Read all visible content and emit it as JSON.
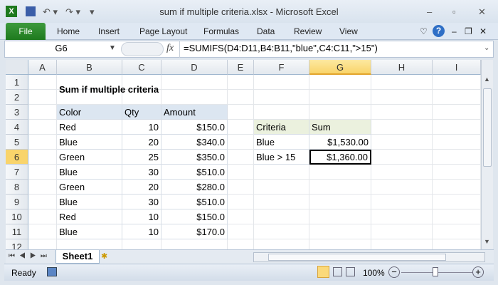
{
  "window": {
    "title": "sum if multiple criteria.xlsx  -  Microsoft Excel"
  },
  "ribbon": {
    "tabs": [
      "File",
      "Home",
      "Insert",
      "Page Layout",
      "Formulas",
      "Data",
      "Review",
      "View"
    ]
  },
  "formula_bar": {
    "name_box": "G6",
    "fx": "fx",
    "formula": "=SUMIFS(D4:D11,B4:B11,\"blue\",C4:C11,\">15\")"
  },
  "columns": [
    "A",
    "B",
    "C",
    "D",
    "E",
    "F",
    "G",
    "H",
    "I"
  ],
  "rows": [
    "1",
    "2",
    "3",
    "4",
    "5",
    "6",
    "7",
    "8",
    "9",
    "10",
    "11",
    "12"
  ],
  "sheet": {
    "title": "Sum if multiple criteria",
    "table_headers": [
      "Color",
      "Qty",
      "Amount"
    ],
    "table_rows": [
      [
        "Red",
        "10",
        "$150.0"
      ],
      [
        "Blue",
        "20",
        "$340.0"
      ],
      [
        "Green",
        "25",
        "$350.0"
      ],
      [
        "Blue",
        "30",
        "$510.0"
      ],
      [
        "Green",
        "20",
        "$280.0"
      ],
      [
        "Blue",
        "30",
        "$510.0"
      ],
      [
        "Red",
        "10",
        "$150.0"
      ],
      [
        "Blue",
        "10",
        "$170.0"
      ]
    ],
    "summary_headers": [
      "Criteria",
      "Sum"
    ],
    "summary_rows": [
      [
        "Blue",
        "$1,530.00"
      ],
      [
        "Blue > 15",
        "$1,360.00"
      ]
    ]
  },
  "sheet_tabs": [
    "Sheet1"
  ],
  "status": {
    "ready": "Ready",
    "zoom": "100%"
  },
  "colors": {
    "table_header": "#dce6f1",
    "summary_header": "#ebf1de",
    "file_tab": "#2a8a2a"
  }
}
